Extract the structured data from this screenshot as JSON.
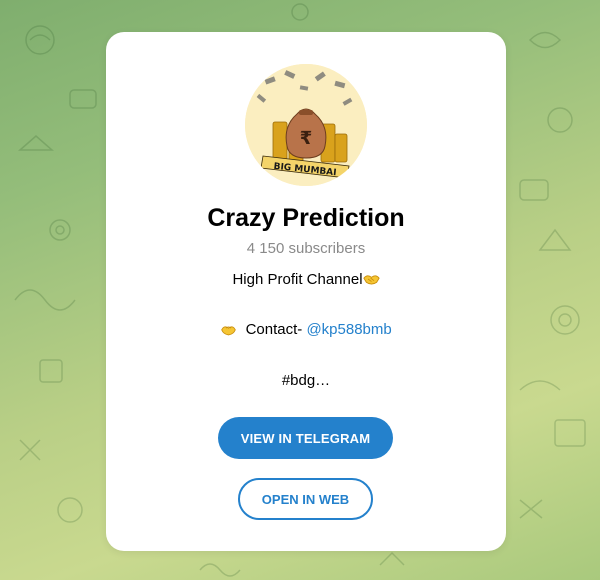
{
  "channel": {
    "title": "Crazy Prediction",
    "subscribers": "4 150 subscribers",
    "avatar_text": "BIG MUMBAI",
    "avatar_symbol": "₹"
  },
  "description": {
    "line1": "High Profit Channel",
    "line1_emoji": "handshake-icon",
    "line2_prefix": "Contact- ",
    "line2_emoji": "hands-heart-icon",
    "line2_link": "@kp588bmb",
    "line3": "#bdg…"
  },
  "buttons": {
    "view_label": "VIEW IN TELEGRAM",
    "web_label": "OPEN IN WEB"
  },
  "colors": {
    "accent": "#2481cc",
    "background_green": "#94bd7a",
    "background_yellow": "#c9d98f",
    "emoji_yellow": "#f5c533",
    "muted_text": "#8a8a8a"
  }
}
